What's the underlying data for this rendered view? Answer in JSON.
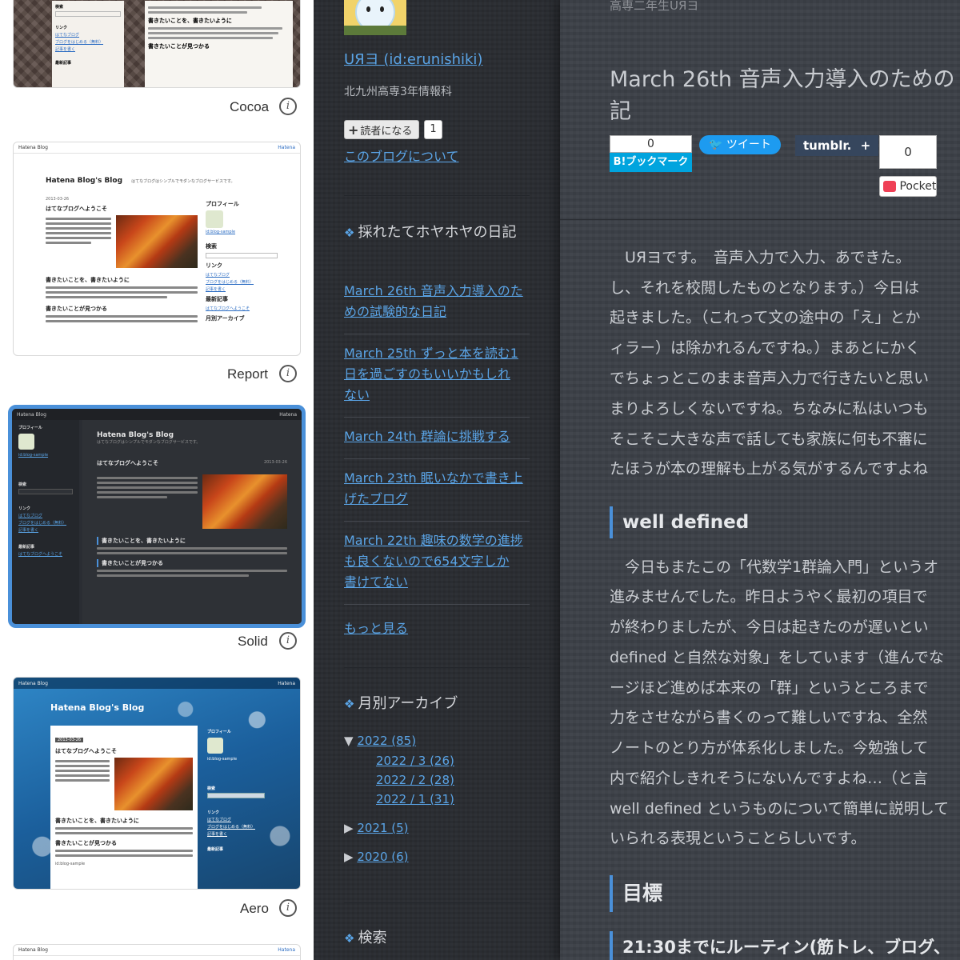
{
  "themes": [
    {
      "label": "Cocoa",
      "selected": false
    },
    {
      "label": "Report",
      "selected": false
    },
    {
      "label": "Solid",
      "selected": true
    },
    {
      "label": "Aero",
      "selected": false
    }
  ],
  "info_glyph": "i",
  "mini": {
    "hatena_blog": "Hatena Blog",
    "blog_title": "Hatena Blog's Blog",
    "blog_desc": "はてなブログはシンプルでモダンなブログサービスです。",
    "welcome": "はてなブログへようこそ",
    "date": "2013-03-26",
    "section1": "書きたいことを、書きたいように",
    "section2": "書きたいことが見つかる",
    "profile": "プロフィール",
    "user": "id:blog-sample",
    "search": "検索",
    "links": "リンク",
    "link1": "はてなブログ",
    "link2": "ブログをはじめる（無料）",
    "link3": "記事を書く",
    "recent": "最新記事",
    "archive": "月別アーカイブ",
    "hatena": "Hatena"
  },
  "sidebar": {
    "author_name": "UЯヨ (id:erunishiki)",
    "bio": "北九州高専3年情報科",
    "follow_label": "読者になる",
    "follow_plus": "+",
    "follower_count": "1",
    "about_link": "このブログについて",
    "recent_heading": "採れたてホヤホヤの日記",
    "recent_posts": [
      {
        "line1": "March 26th 音声入力導入のた",
        "line2": "めの試験的な日記",
        "line3": ""
      },
      {
        "line1": "March 25th ずっと本を読む1",
        "line2": "日を過ごすのもいいかもしれ",
        "line3": "ない"
      },
      {
        "line1": "March 24th 群論に挑戦する",
        "line2": "",
        "line3": ""
      },
      {
        "line1": "March 23th 眠いなかで書き上",
        "line2": "げたブログ",
        "line3": ""
      },
      {
        "line1": "March 22th 趣味の数学の進捗",
        "line2": "も良くないので654文字しか",
        "line3": "書けてない"
      }
    ],
    "more_link": "もっと見る",
    "archive_heading": "月別アーカイブ",
    "archive": {
      "y2022": "2022 (85)",
      "y2022_expanded_arrow": "▼",
      "months": [
        "2022 / 3 (26)",
        "2022 / 2 (28)",
        "2022 / 1 (31)"
      ],
      "y2021": "2021 (5)",
      "y2020": "2020 (6)",
      "collapsed_arrow": "▶"
    },
    "search_heading": "検索"
  },
  "main": {
    "header_blog": "高専二年生UЯヨ",
    "title_line1": "March 26th 音声入力導入のための",
    "title_line2": "記",
    "bookmark_count": "0",
    "bookmark_label": "B!ブックマーク",
    "tweet_label": "ツイート",
    "tumblr_label": "tumblr.",
    "tumblr_plus": "+",
    "pocket_count": "0",
    "pocket_label": "Pocket",
    "paragraph1": [
      "　UЯヨです。　音声入力で入力、あできた。",
      "し、それを校閲したものとなります。）今日は",
      "起きました。（これって文の途中の「え」とか",
      "ィラー）は除かれるんですね。）まあとにかく",
      "でちょっとこのまま音声入力で行きたいと思い",
      "まりよろしくないですね。ちなみに私はいつも",
      "そこそこ大きな声で話しても家族に何も不審に",
      "たほうが本の理解も上がる気がするんですよね"
    ],
    "heading_well_defined": "well defined",
    "paragraph2": [
      "　今日もまたこの「代数学1群論入門」というオ",
      "進みませんでした。昨日ようやく最初の項目で",
      "が終わりましたが、今日は起きたのが遅いとい",
      "defined と自然な対象」をしています（進んでな",
      "ージほど進めば本来の「群」というところまで",
      "力をさせながら書くのって難しいですね、全然",
      "ノートのとり方が体系化しました。今勉強して",
      "内で紹介しきれそうにないんですよね…（と言",
      "well defined というものについて簡単に説明して",
      "いられる表現ということらしいです。"
    ],
    "heading_goal": "目標",
    "heading_routine": "21:30までにルーティン(筋トレ、ブログ、"
  }
}
